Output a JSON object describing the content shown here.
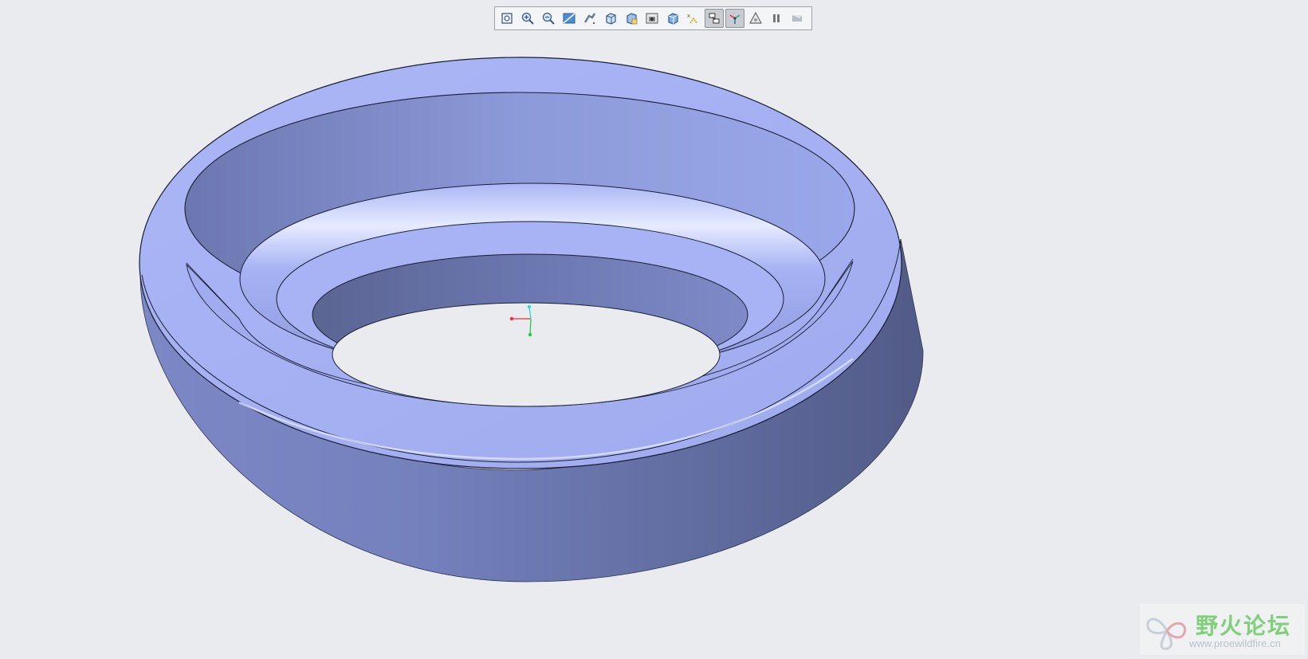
{
  "toolbar": {
    "buttons": [
      {
        "name": "refit-icon",
        "active": false
      },
      {
        "name": "zoom-in-icon",
        "active": false
      },
      {
        "name": "zoom-out-icon",
        "active": false
      },
      {
        "name": "repaint-icon",
        "active": false
      },
      {
        "name": "display-style-icon",
        "active": false
      },
      {
        "name": "saved-orientations-icon",
        "active": false
      },
      {
        "name": "view-manager-icon",
        "active": false
      },
      {
        "name": "perspective-view-icon",
        "active": false
      },
      {
        "name": "section-icon",
        "active": false
      },
      {
        "name": "datum-display-icon",
        "active": false
      },
      {
        "name": "annotation-display-icon",
        "active": true
      },
      {
        "name": "spin-center-icon",
        "active": true
      },
      {
        "name": "appearance-icon",
        "active": false
      },
      {
        "name": "pause-icon",
        "active": false
      },
      {
        "name": "last-icon",
        "active": false
      }
    ]
  },
  "model": {
    "colors": {
      "face_light": "#a9b5f5",
      "face_mid": "#8d9bdc",
      "face_dark": "#5d6794",
      "background": "#e9ebee",
      "edge": "#1a1f33"
    }
  },
  "triad": {
    "x_color": "#ff2a2a",
    "y_color": "#22cc44",
    "z_color": "#22dddd"
  },
  "watermark": {
    "chinese": "野火论坛",
    "url": "www.proewildfire.cn"
  }
}
